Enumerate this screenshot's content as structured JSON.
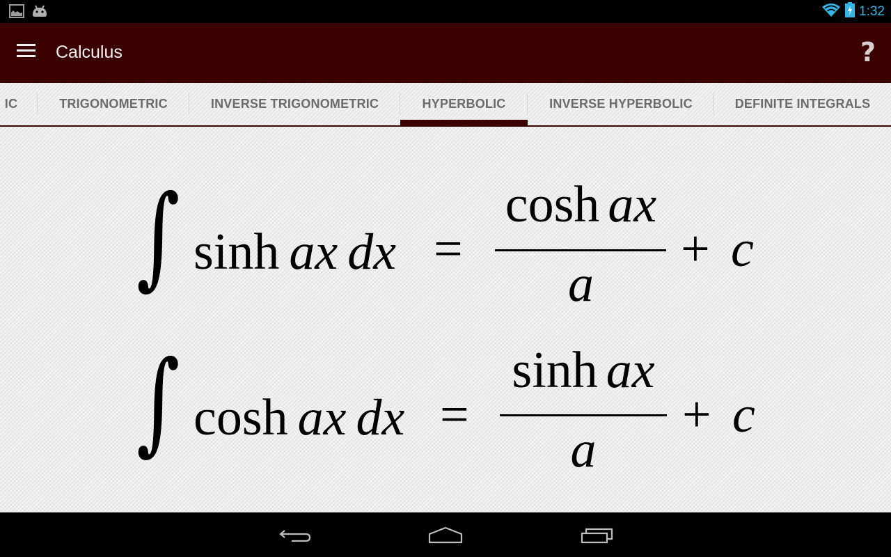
{
  "status_bar": {
    "left_icons": [
      "image-notification-icon",
      "android-notification-icon"
    ],
    "right_icons": [
      "wifi-icon",
      "battery-charging-icon"
    ],
    "time": "1:32",
    "accent_color": "#33b5e5"
  },
  "action_bar": {
    "title": "Calculus",
    "menu_icon": "hamburger-menu-icon",
    "help_label": "?",
    "background_color": "#3b0000"
  },
  "tabs": {
    "items": [
      {
        "label": "IC",
        "active": false
      },
      {
        "label": "TRIGONOMETRIC",
        "active": false
      },
      {
        "label": "INVERSE TRIGONOMETRIC",
        "active": false
      },
      {
        "label": "HYPERBOLIC",
        "active": true
      },
      {
        "label": "INVERSE HYPERBOLIC",
        "active": false
      },
      {
        "label": "DEFINITE INTEGRALS",
        "active": false
      }
    ],
    "indicator_color": "#3b0000"
  },
  "formulas": [
    {
      "integral": "∫",
      "integrand_fn": "sinh",
      "integrand_var": "ax",
      "differential": "dx",
      "equals": "=",
      "numerator_fn": "cosh",
      "numerator_var": "ax",
      "denominator": "a",
      "plus": "+",
      "constant": "c"
    },
    {
      "integral": "∫",
      "integrand_fn": "cosh",
      "integrand_var": "ax",
      "differential": "dx",
      "equals": "=",
      "numerator_fn": "sinh",
      "numerator_var": "ax",
      "denominator": "a",
      "plus": "+",
      "constant": "c"
    }
  ],
  "nav_bar": {
    "buttons": [
      "back-icon",
      "home-icon",
      "recent-apps-icon"
    ]
  }
}
